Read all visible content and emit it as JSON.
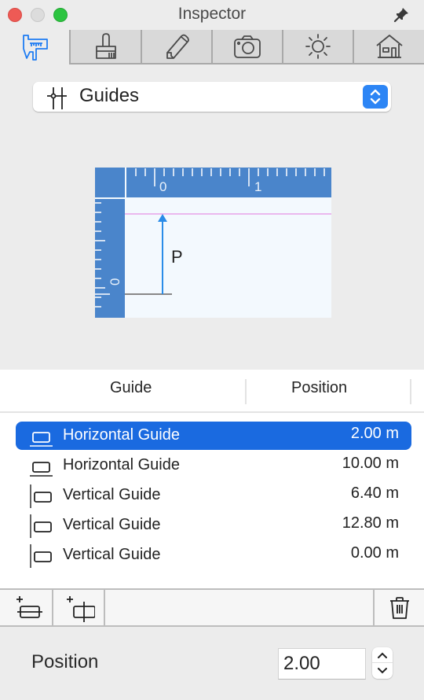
{
  "window": {
    "title": "Inspector"
  },
  "tabs": [
    {
      "name": "measure",
      "icon": "caliper-icon",
      "active": true
    },
    {
      "name": "style",
      "icon": "brush-icon",
      "active": false
    },
    {
      "name": "edit",
      "icon": "pencil-icon",
      "active": false
    },
    {
      "name": "camera",
      "icon": "camera-icon",
      "active": false
    },
    {
      "name": "light",
      "icon": "sun-icon",
      "active": false
    },
    {
      "name": "building",
      "icon": "house-icon",
      "active": false
    }
  ],
  "mode_popup": {
    "selected": "Guides",
    "icon": "guides-icon"
  },
  "diagram": {
    "ruler_top_labels": [
      "0",
      "1"
    ],
    "ruler_left_labels": [
      "0"
    ],
    "arrow_label": "P",
    "colors": {
      "ruler": "#4a85cb",
      "canvas": "#f3f9fe",
      "guide_line": "#e8a3e8",
      "arrow": "#2a8ce8",
      "baseline": "#888888"
    }
  },
  "guide_list": {
    "columns": [
      "Guide",
      "Position"
    ],
    "rows": [
      {
        "type": "horizontal",
        "name": "Horizontal Guide",
        "position": "2.00 m",
        "selected": true
      },
      {
        "type": "horizontal",
        "name": "Horizontal Guide",
        "position": "10.00 m",
        "selected": false
      },
      {
        "type": "vertical",
        "name": "Vertical Guide",
        "position": "6.40 m",
        "selected": false
      },
      {
        "type": "vertical",
        "name": "Vertical Guide",
        "position": "12.80 m",
        "selected": false
      },
      {
        "type": "vertical",
        "name": "Vertical Guide",
        "position": "0.00 m",
        "selected": false
      }
    ]
  },
  "toolbar": {
    "add_horizontal": "add-horizontal-guide-icon",
    "add_vertical": "add-vertical-guide-icon",
    "delete": "trash-icon"
  },
  "position_field": {
    "label": "Position",
    "value": "2.00"
  },
  "colors": {
    "accent": "#1a6ae0",
    "tab_active_icon": "#1e7cf2",
    "popup_stepper": "#2c85f5"
  }
}
